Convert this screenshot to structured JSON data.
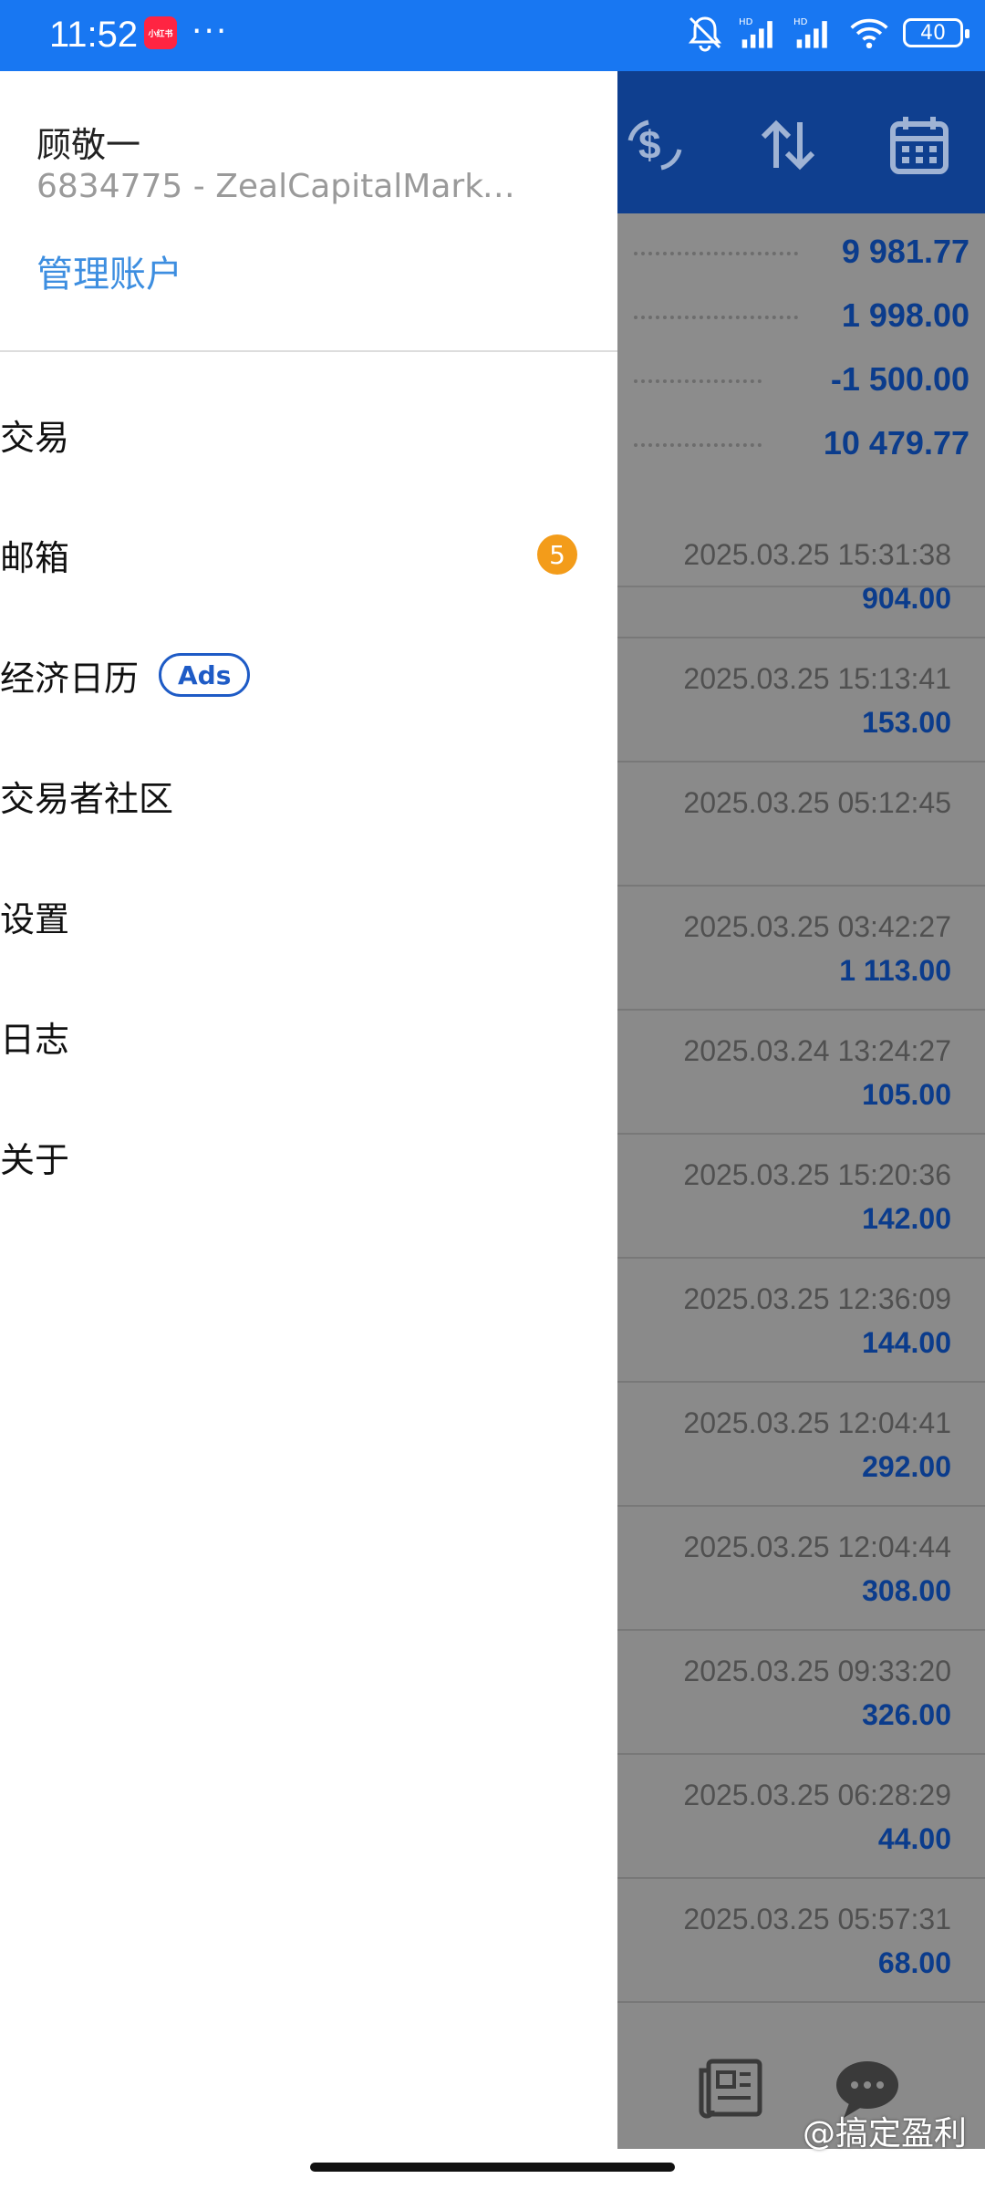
{
  "status_bar": {
    "time": "11:52",
    "app_badge": "小红书",
    "more": "···",
    "battery": "40",
    "icons": [
      "mute-bell-icon",
      "hd-signal-icon",
      "hd-signal-icon",
      "wifi-icon",
      "battery-icon"
    ]
  },
  "drawer": {
    "account_name": "顾敬一",
    "account_id": "6834775 - ZealCapitalMarket...",
    "manage_label": "管理账户",
    "items": [
      {
        "label": "交易"
      },
      {
        "label": "邮箱",
        "badge": "5"
      },
      {
        "label": "经济日历",
        "tag": "Ads"
      },
      {
        "label": "交易者社区"
      },
      {
        "label": "设置"
      },
      {
        "label": "日志"
      },
      {
        "label": "关于"
      }
    ]
  },
  "background_app": {
    "toolbar_icons": [
      "currency-exchange-icon",
      "sort-icon",
      "calendar-icon"
    ],
    "summary_values": [
      "9 981.77",
      "1 998.00",
      "-1 500.00",
      "10 479.77"
    ],
    "history": [
      {
        "date": "2025.03.25 15:31:38",
        "amount": "904.00"
      },
      {
        "date": "2025.03.25 15:13:41",
        "amount": "153.00"
      },
      {
        "date": "2025.03.25 05:12:45",
        "amount": ""
      },
      {
        "date": "2025.03.25 03:42:27",
        "amount": "1 113.00"
      },
      {
        "date": "2025.03.24 13:24:27",
        "amount": "105.00"
      },
      {
        "date": "2025.03.25 15:20:36",
        "amount": "142.00"
      },
      {
        "date": "2025.03.25 12:36:09",
        "amount": "144.00"
      },
      {
        "date": "2025.03.25 12:04:41",
        "amount": "292.00"
      },
      {
        "date": "2025.03.25 12:04:44",
        "amount": "308.00"
      },
      {
        "date": "2025.03.25 09:33:20",
        "amount": "326.00"
      },
      {
        "date": "2025.03.25 06:28:29",
        "amount": "44.00"
      },
      {
        "date": "2025.03.25 05:57:31",
        "amount": "68.00"
      }
    ],
    "bottom_icons": [
      "news-icon",
      "chat-icon"
    ]
  },
  "watermark": "@搞定盈利",
  "colors": {
    "status_bar": "#1877f2",
    "toolbar": "#0f3f8f",
    "value_blue": "#0b3c8c",
    "link_blue": "#3d8ee0",
    "badge_orange": "#f39c1a",
    "overlay_gray": "#8a8a8a"
  }
}
